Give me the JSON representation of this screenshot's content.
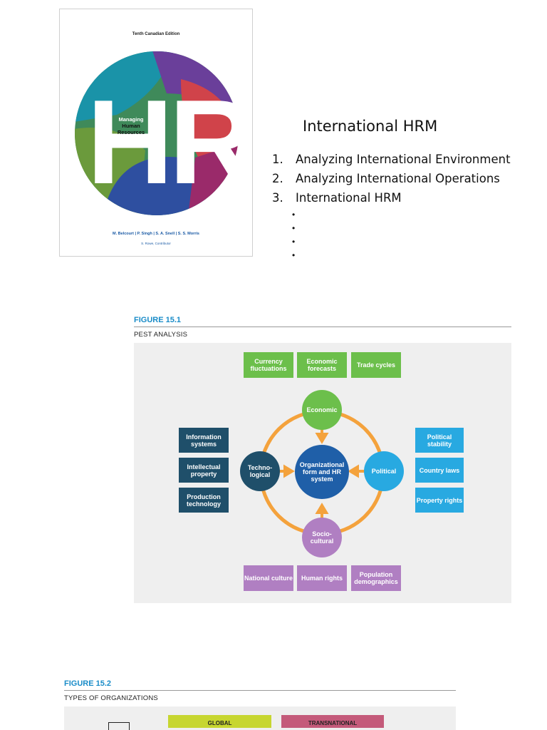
{
  "cover": {
    "edition": "Tenth Canadian Edition",
    "big_letters": "HR",
    "subtitle_line1": "Managing",
    "subtitle_line2": "Human",
    "subtitle_line3": "Resources",
    "authors": "M. Belcourt | P. Singh | S. A. Snell | S. S. Morris",
    "contributor": "S. Rowe, Contributor"
  },
  "outline": {
    "title": "International HRM",
    "items": [
      {
        "num": "1.",
        "label": "Analyzing International Environment"
      },
      {
        "num": "2.",
        "label": "Analyzing International Operations"
      },
      {
        "num": "3.",
        "label": "International HRM"
      }
    ],
    "sub_bullets": [
      "•",
      "•",
      "•",
      "•"
    ]
  },
  "figure1": {
    "label": "FIGURE 15.1",
    "caption": "PEST ANALYSIS",
    "economic_boxes": [
      "Currency fluctuations",
      "Economic forecasts",
      "Trade cycles"
    ],
    "technological_boxes": [
      "Information systems",
      "Intellectual property",
      "Production technology"
    ],
    "political_boxes": [
      "Political stability",
      "Country laws",
      "Property rights"
    ],
    "sociocultural_boxes": [
      "National culture",
      "Human rights",
      "Population demographics"
    ],
    "center": "Organizational form and HR system",
    "economic": "Economic",
    "technological": "Techno-logical",
    "political": "Political",
    "sociocultural": "Socio-cultural",
    "colors": {
      "economic": "#6cbf4b",
      "technological": "#1f4f6a",
      "political": "#28a9e1",
      "sociocultural": "#b07fc2",
      "center": "#1f5fa8",
      "ring": "#f4a23c"
    }
  },
  "figure2": {
    "label": "FIGURE 15.2",
    "caption": "TYPES OF ORGANIZATIONS",
    "tags": [
      "GLOBAL",
      "TRANSNATIONAL"
    ]
  }
}
